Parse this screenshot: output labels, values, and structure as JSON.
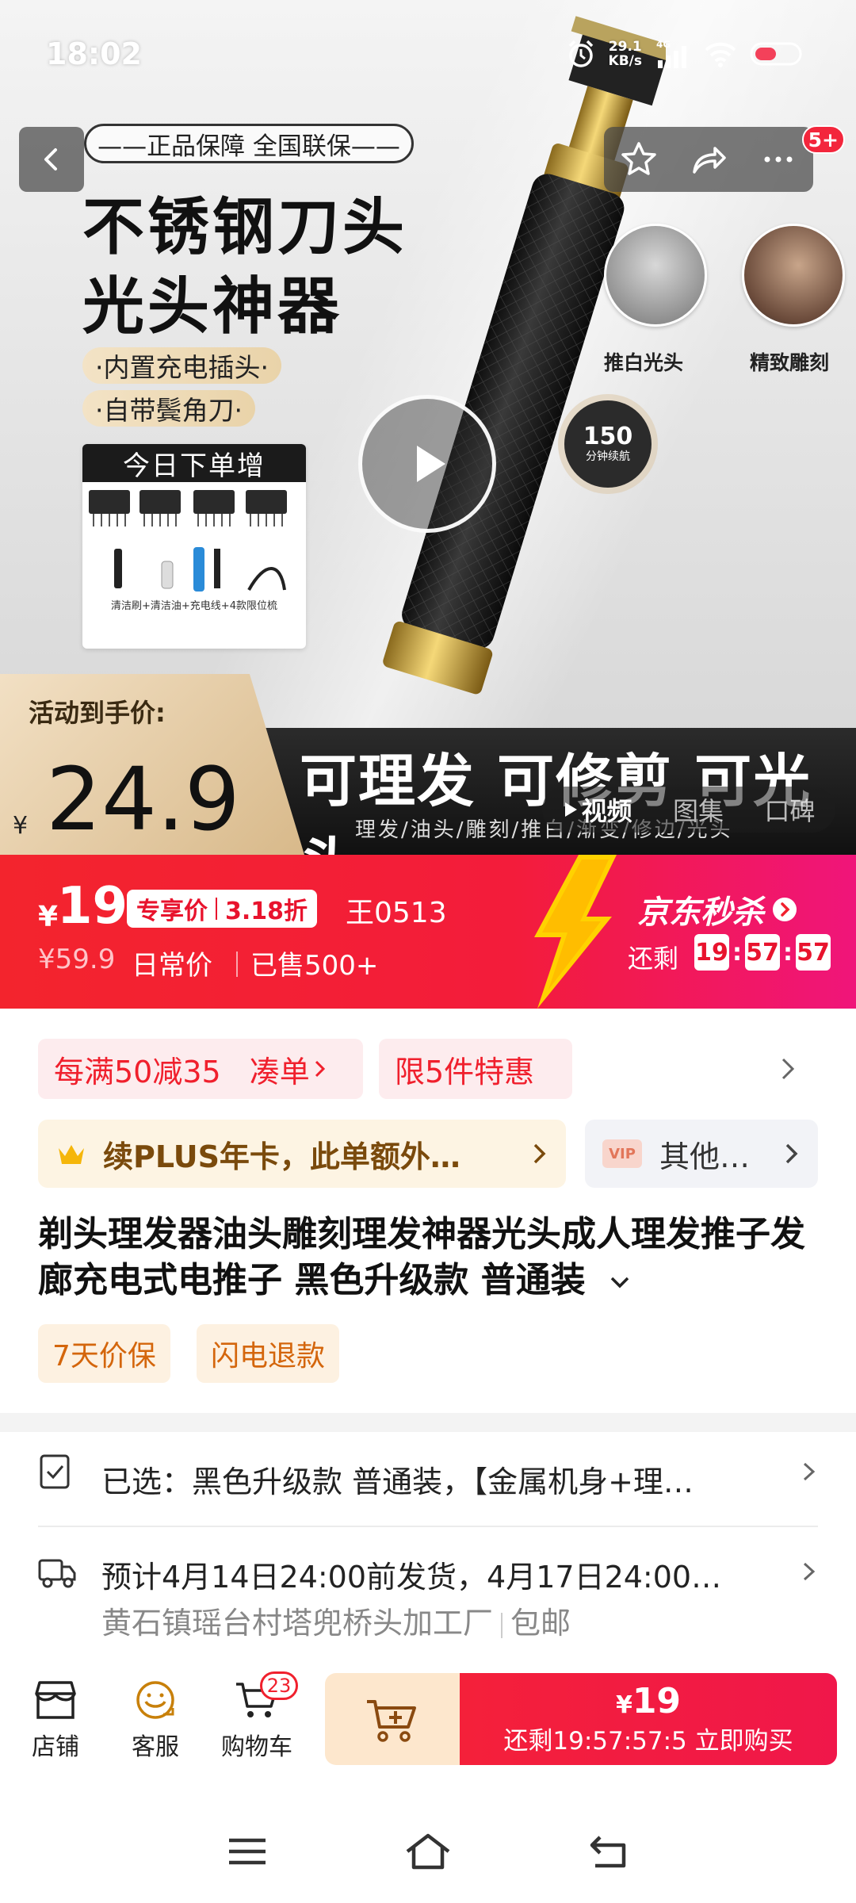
{
  "status_bar": {
    "time": "18:02",
    "net_speed_value": "29.1",
    "net_speed_unit": "KB/s",
    "network": "4G"
  },
  "hero": {
    "guarantee": "——正品保障 全国联保——",
    "headline_1": "不锈钢刀头",
    "headline_2": "光头神器",
    "pill_1": "·内置充电插头·",
    "pill_2": "·自带鬓角刀·",
    "gift_title": "今日下单增",
    "gift_caption": "清洁刷+清洁油+充电线+4款限位梳",
    "thumb_label_1": "推白光头",
    "thumb_label_2": "精致雕刻",
    "battery_num": "150",
    "battery_sub": "分钟续航",
    "activity_label": "活动到手价:",
    "activity_yen": "¥",
    "activity_price": "24.9",
    "slogan": "可理发 可修剪 可光头",
    "slogan_sub": "理发/油头/雕刻/推白/渐变/修边/光头",
    "more_badge": "5+",
    "media_tabs": [
      "视频",
      "图集",
      "口碑"
    ]
  },
  "price_band": {
    "yen": "¥",
    "price": "19",
    "tag_left": "专享价",
    "tag_right": "3.18折",
    "code": "王0513",
    "original": "¥59.9",
    "daily_label": "日常价",
    "sold": "已售500+",
    "brand": "京东秒杀",
    "remaining_label": "还剩",
    "timer": [
      "19",
      "57",
      "57"
    ]
  },
  "promos": {
    "promo_1": "每满50减35",
    "promo_1_action": "凑单",
    "promo_2": "限5件特惠",
    "plus_text": "续PLUS年卡，此单额外…",
    "vip_tag": "VIP",
    "other_text": "其他…"
  },
  "product": {
    "title": "剃头理发器油头雕刻理发神器光头成人理发推子发廊充电式电推子 黑色升级款 普通装",
    "tags": [
      "7天价保",
      "闪电退款"
    ]
  },
  "selected": {
    "text": "已选：黑色升级款 普通装，【金属机身+理…"
  },
  "shipping": {
    "text": "预计4月14日24:00前发货，4月17日24:00…",
    "origin": "黄石镇瑶台村塔兜桥头加工厂",
    "free": "包邮"
  },
  "action_bar": {
    "store": "店铺",
    "service": "客服",
    "cart": "购物车",
    "cart_count": "23",
    "buy_yen": "¥",
    "buy_price": "19",
    "buy_sub": "还剩19:57:57:5 立即购买"
  },
  "colors": {
    "accent_red": "#f3242d",
    "promo_text": "#f0202d",
    "plus_gold": "#7a4a0c"
  }
}
